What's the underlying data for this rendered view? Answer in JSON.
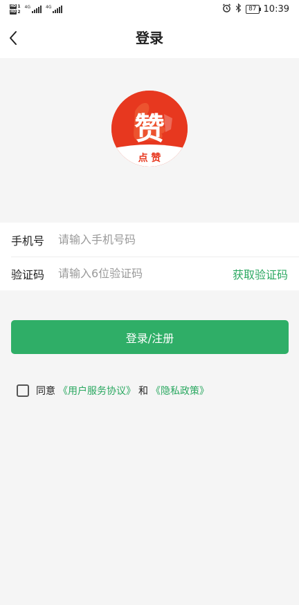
{
  "status_bar": {
    "hd1": "HD",
    "hd1_num": "1",
    "hd2": "HD",
    "hd2_num": "2",
    "net1": "4G",
    "net2": "4G",
    "battery": "87",
    "time": "10:39"
  },
  "nav": {
    "title": "登录"
  },
  "logo": {
    "text": "点 赞",
    "glyph": "赞"
  },
  "form": {
    "phone_label": "手机号",
    "phone_placeholder": "请输入手机号码",
    "phone_value": "",
    "code_label": "验证码",
    "code_placeholder": "请输入6位验证码",
    "code_value": "",
    "get_code": "获取验证码"
  },
  "login_button": "登录/注册",
  "agreement": {
    "prefix": "同意",
    "terms": "《用户服务协议》",
    "and": "和",
    "privacy": "《隐私政策》"
  },
  "colors": {
    "accent_green": "#2fae67",
    "logo_red": "#e7381f"
  }
}
